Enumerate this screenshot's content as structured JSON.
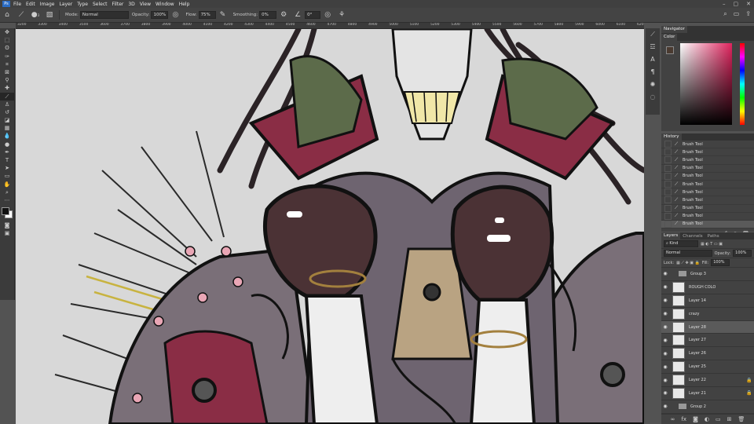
{
  "menu": [
    "File",
    "Edit",
    "Image",
    "Layer",
    "Type",
    "Select",
    "Filter",
    "3D",
    "View",
    "Window",
    "Help"
  ],
  "app_logo": "Ps",
  "window_controls": [
    "–",
    "▢",
    "✕"
  ],
  "options": {
    "mode_label": "Mode:",
    "mode_value": "Normal",
    "opacity_label": "Opacity:",
    "opacity_value": "100%",
    "flow_label": "Flow:",
    "flow_value": "75%",
    "smoothing_label": "Smoothing:",
    "smoothing_value": "0%",
    "angle_value": "0°",
    "brush_size": "3"
  },
  "ruler_ticks": [
    "3200",
    "3300",
    "3400",
    "3500",
    "3600",
    "3700",
    "3800",
    "3900",
    "4000",
    "4100",
    "4200",
    "4300",
    "4400",
    "4500",
    "4600",
    "4700",
    "4800",
    "4900",
    "5000",
    "5100",
    "5200",
    "5300",
    "5400",
    "5500",
    "5600",
    "5700",
    "5800",
    "5900",
    "6000",
    "6100",
    "6200",
    "6300",
    "6400",
    "6500",
    "6600",
    "6700",
    "6800",
    "6900",
    "7000",
    "7100",
    "7200",
    "7300",
    "7400",
    "7500",
    "7600",
    "7700",
    "7800",
    "7900",
    "8000",
    "8100",
    "8200",
    "8300",
    "8400",
    "8500",
    "8600",
    "8700",
    "8800",
    "8900",
    "9000",
    "9100"
  ],
  "navigator_tab": "Navigator",
  "color_tab": "Color",
  "history": {
    "tab": "History",
    "items": [
      "Brush Tool",
      "Brush Tool",
      "Brush Tool",
      "Brush Tool",
      "Brush Tool",
      "Brush Tool",
      "Brush Tool",
      "Brush Tool",
      "Brush Tool",
      "Brush Tool",
      "Brush Tool"
    ]
  },
  "layers": {
    "tabs": [
      "Layers",
      "Channels",
      "Paths"
    ],
    "kind_value": "Kind",
    "blend_value": "Normal",
    "opacity_label": "Opacity:",
    "opacity_value": "100%",
    "lock_label": "Lock:",
    "fill_label": "Fill:",
    "fill_value": "100%",
    "items": [
      {
        "name": "Group 3",
        "type": "group"
      },
      {
        "name": "ROUGH COLO",
        "type": "layer"
      },
      {
        "name": "Layer 14",
        "type": "layer"
      },
      {
        "name": "crazy",
        "type": "layer"
      },
      {
        "name": "Layer 28",
        "type": "layer"
      },
      {
        "name": "Layer 27",
        "type": "layer"
      },
      {
        "name": "Layer 26",
        "type": "layer"
      },
      {
        "name": "Layer 25",
        "type": "layer"
      },
      {
        "name": "Layer 22",
        "type": "layer"
      },
      {
        "name": "Layer 21",
        "type": "layer"
      },
      {
        "name": "Group 2",
        "type": "group"
      }
    ]
  },
  "colors": {
    "accent": "#e0245e",
    "foreground": "#111111",
    "background": "#ffffff"
  }
}
